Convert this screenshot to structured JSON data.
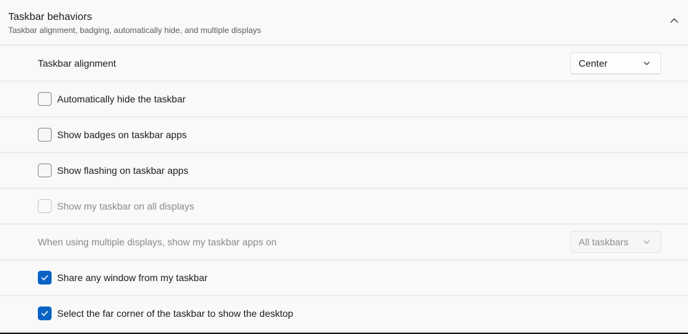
{
  "header": {
    "title": "Taskbar behaviors",
    "subtitle": "Taskbar alignment, badging, automatically hide, and multiple displays"
  },
  "alignment": {
    "label": "Taskbar alignment",
    "value": "Center"
  },
  "options": [
    {
      "label": "Automatically hide the taskbar",
      "checked": false,
      "enabled": true
    },
    {
      "label": "Show badges on taskbar apps",
      "checked": false,
      "enabled": true
    },
    {
      "label": "Show flashing on taskbar apps",
      "checked": false,
      "enabled": true
    },
    {
      "label": "Show my taskbar on all displays",
      "checked": false,
      "enabled": false
    }
  ],
  "multi_display": {
    "label": "When using multiple displays, show my taskbar apps on",
    "value": "All taskbars",
    "enabled": false
  },
  "options2": [
    {
      "label": "Share any window from my taskbar",
      "checked": true,
      "enabled": true
    },
    {
      "label": "Select the far corner of the taskbar to show the desktop",
      "checked": true,
      "enabled": true
    }
  ],
  "colors": {
    "accent": "#0a63c4",
    "background": "#f3f3f3",
    "card": "#f9f9f9"
  }
}
